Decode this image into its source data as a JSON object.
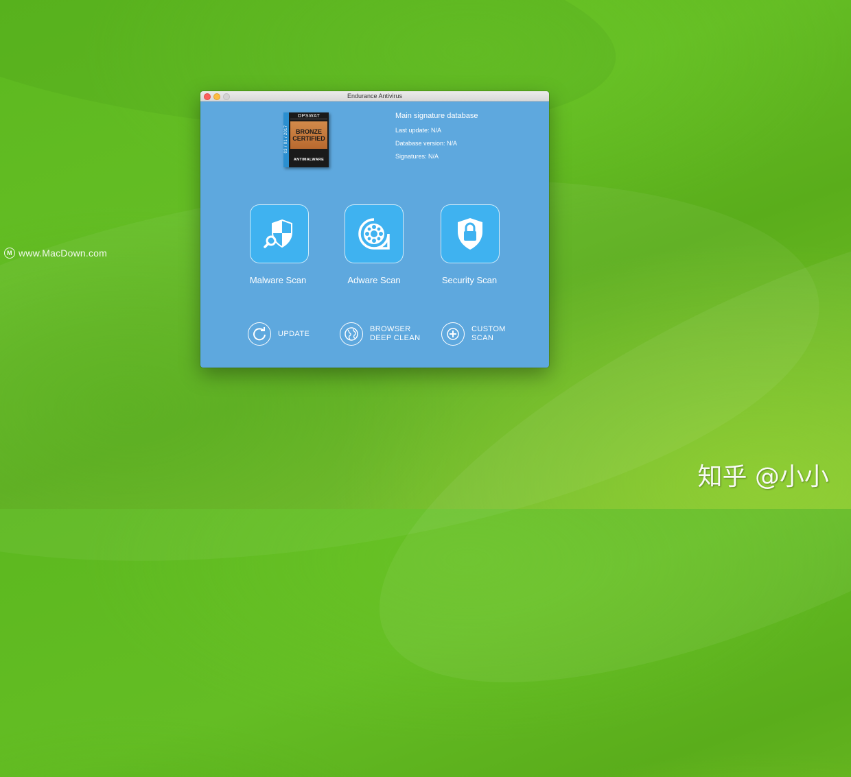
{
  "desktop": {
    "watermark_left": "www.MacDown.com",
    "watermark_left_logo": "M",
    "watermark_right": "知乎 @小小"
  },
  "window": {
    "title": "Endurance Antivirus"
  },
  "badge": {
    "brand": "OPSWAT",
    "tier_line1": "BRONZE",
    "tier_line2": "CERTIFIED",
    "kind": "ANTIMALWARE",
    "date": "03 / 01 / 2017"
  },
  "database": {
    "title": "Main signature database",
    "last_update": "Last update: N/A",
    "version": "Database version: N/A",
    "signatures": "Signatures: N/A"
  },
  "scans": [
    {
      "label": "Malware Scan",
      "icon": "shield-search-icon"
    },
    {
      "label": "Adware Scan",
      "icon": "virus-gear-icon"
    },
    {
      "label": "Security Scan",
      "icon": "shield-lock-icon"
    }
  ],
  "actions": [
    {
      "line1": "UPDATE",
      "line2": "",
      "icon": "refresh-icon"
    },
    {
      "line1": "BROWSER",
      "line2": "DEEP CLEAN",
      "icon": "globe-icon"
    },
    {
      "line1": "CUSTOM",
      "line2": "SCAN",
      "icon": "plus-circle-icon"
    }
  ],
  "colors": {
    "window_bg": "#5ea8de",
    "tile_bg": "#3fb2f0",
    "badge_orange": "#c97a3c"
  }
}
